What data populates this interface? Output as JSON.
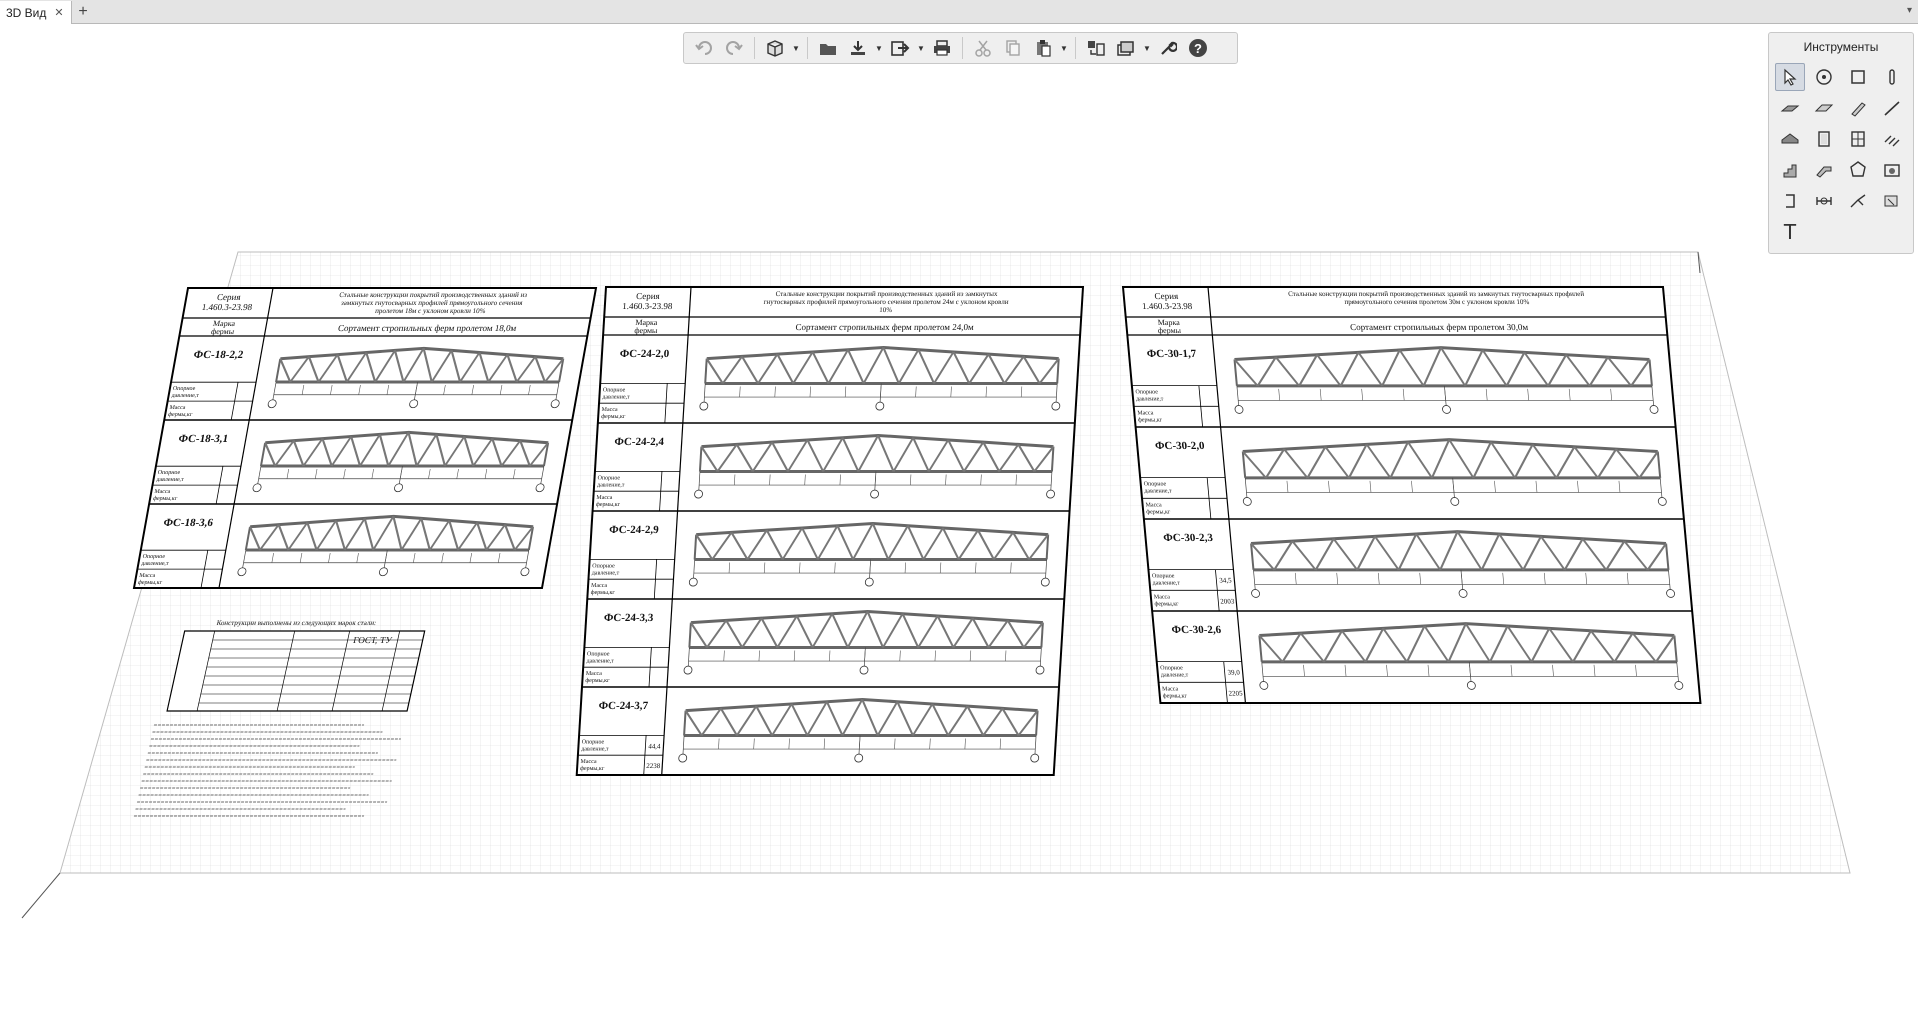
{
  "tab": {
    "title": "3D Вид",
    "close": "✕",
    "add": "+",
    "menu": "▾"
  },
  "palette": {
    "title": "Инструменты",
    "text_tool": "T"
  },
  "drawing": {
    "series_label": "Серия 1.460.3-23.98",
    "mark_label": "Марка фермы",
    "sections": [
      {
        "title": "Стальные конструкции покрытий производственных зданий из замкнутых гнутосварных профилей прямоугольного сечения пролетом 18м с уклоном кровли 10%",
        "subtitle": "Сортамент стропильных ферм пролетом 18,0м",
        "trusses": [
          {
            "mark": "ФС-18-2,2"
          },
          {
            "mark": "ФС-18-3,1"
          },
          {
            "mark": "ФС-18-3,6"
          }
        ]
      },
      {
        "title": "Стальные конструкции покрытий производственных зданий из замкнутых гнутосварных профилей прямоугольного сечения пролетом 24м с уклоном кровли 10%",
        "subtitle": "Сортамент стропильных ферм пролетом 24,0м",
        "trusses": [
          {
            "mark": "ФС-24-2,0"
          },
          {
            "mark": "ФС-24-2,4"
          },
          {
            "mark": "ФС-24-2,9"
          },
          {
            "mark": "ФС-24-3,3"
          },
          {
            "mark": "ФС-24-3,7",
            "support": "44,4",
            "mass": "2238"
          }
        ]
      },
      {
        "title": "Стальные конструкции покрытий производственных зданий из замкнутых гнутосварных профилей прямоугольного сечения пролетом 30м с уклоном кровли 10%",
        "subtitle": "Сортамент стропильных ферм пролетом 30,0м",
        "trusses": [
          {
            "mark": "ФС-30-1,7"
          },
          {
            "mark": "ФС-30-2,0"
          },
          {
            "mark": "ФС-30-2,3",
            "support": "34,5",
            "mass": "2003"
          },
          {
            "mark": "ФС-30-2,6",
            "support": "39,0",
            "mass": "2205"
          }
        ]
      }
    ],
    "row_labels": {
      "support": "Опорное давление,т",
      "mass": "Масса фермы,кг"
    },
    "small_table": {
      "title": "Конструкции выполнены из следующих марок стали:",
      "gost": "ГОСТ, ТУ"
    }
  }
}
